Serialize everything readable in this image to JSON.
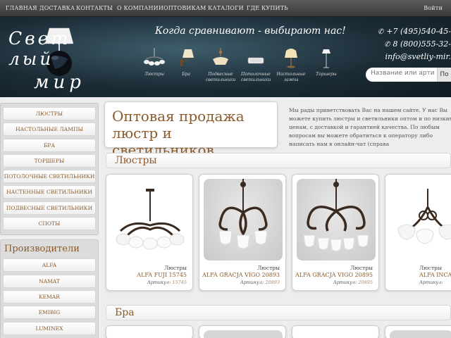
{
  "topnav": {
    "items": [
      "ГЛАВНАЯ",
      "ДОСТАВКА",
      "КОНТАКТЫ",
      "О КОМПАНИИ",
      "ОПТОВИКАМ",
      "КАТАЛОГИ",
      "ГДЕ КУПИТЬ"
    ],
    "login": "Войти"
  },
  "header": {
    "logo_word1": "Свет лый",
    "logo_word2": "мир",
    "slogan": "Когда сравнивают - выбирают нас!",
    "categories": [
      "Люстры",
      "Бра",
      "Подвесные светильники",
      "Потолочные светильники",
      "Настольные лампы",
      "Торшеры"
    ],
    "phone1": "+7 (495)540-45-",
    "phone2": "8 (800)555-32-",
    "email": "info@svetliy-mir.",
    "search_placeholder": "Название или артикул",
    "search_button": "По"
  },
  "sidebar": {
    "items": [
      "ЛЮСТРЫ",
      "НАСТОЛЬНЫЕ ЛАМПЫ",
      "БРА",
      "ТОРШЕРЫ",
      "ПОТОЛОЧНЫЕ СВЕТИЛЬНИКИ",
      "НАСТЕННЫЕ СВЕТИЛЬНИКИ",
      "ПОДВЕСНЫЕ СВЕТИЛЬНИКИ",
      "СПОТЫ"
    ],
    "brands_title": "Производители",
    "brands": [
      "ALFA",
      "NAMAT",
      "KEMAR",
      "EMIBIG",
      "LUMINEX"
    ]
  },
  "main": {
    "title_line1": "Оптовая продажа",
    "title_line2": "люстр и светильников",
    "intro": "Мы рады приветствовать Вас на нашем сайте. У нас Вы можете купить люстры и светильники оптом и по низким ценам, с доставкой и гарантией качества. По любым вопросам вы можете обратиться к оператору либо написать нам в онлайн-чат (справа",
    "section1": "Люстры",
    "section2": "Бра",
    "products": [
      {
        "category": "Люстры",
        "name": "ALFA FUJI 15745",
        "sku_label": "Артикул:",
        "sku": "15745"
      },
      {
        "category": "Люстры",
        "name": "ALFA GRACJA VIGO 20893",
        "sku_label": "Артикул:",
        "sku": "20893"
      },
      {
        "category": "Люстры",
        "name": "ALFA GRACJA VIGO 20895",
        "sku_label": "Артикул:",
        "sku": "20895"
      },
      {
        "category": "Люстры",
        "name": "ALFA INCA",
        "sku_label": "Артикул:",
        "sku": ""
      }
    ]
  }
}
